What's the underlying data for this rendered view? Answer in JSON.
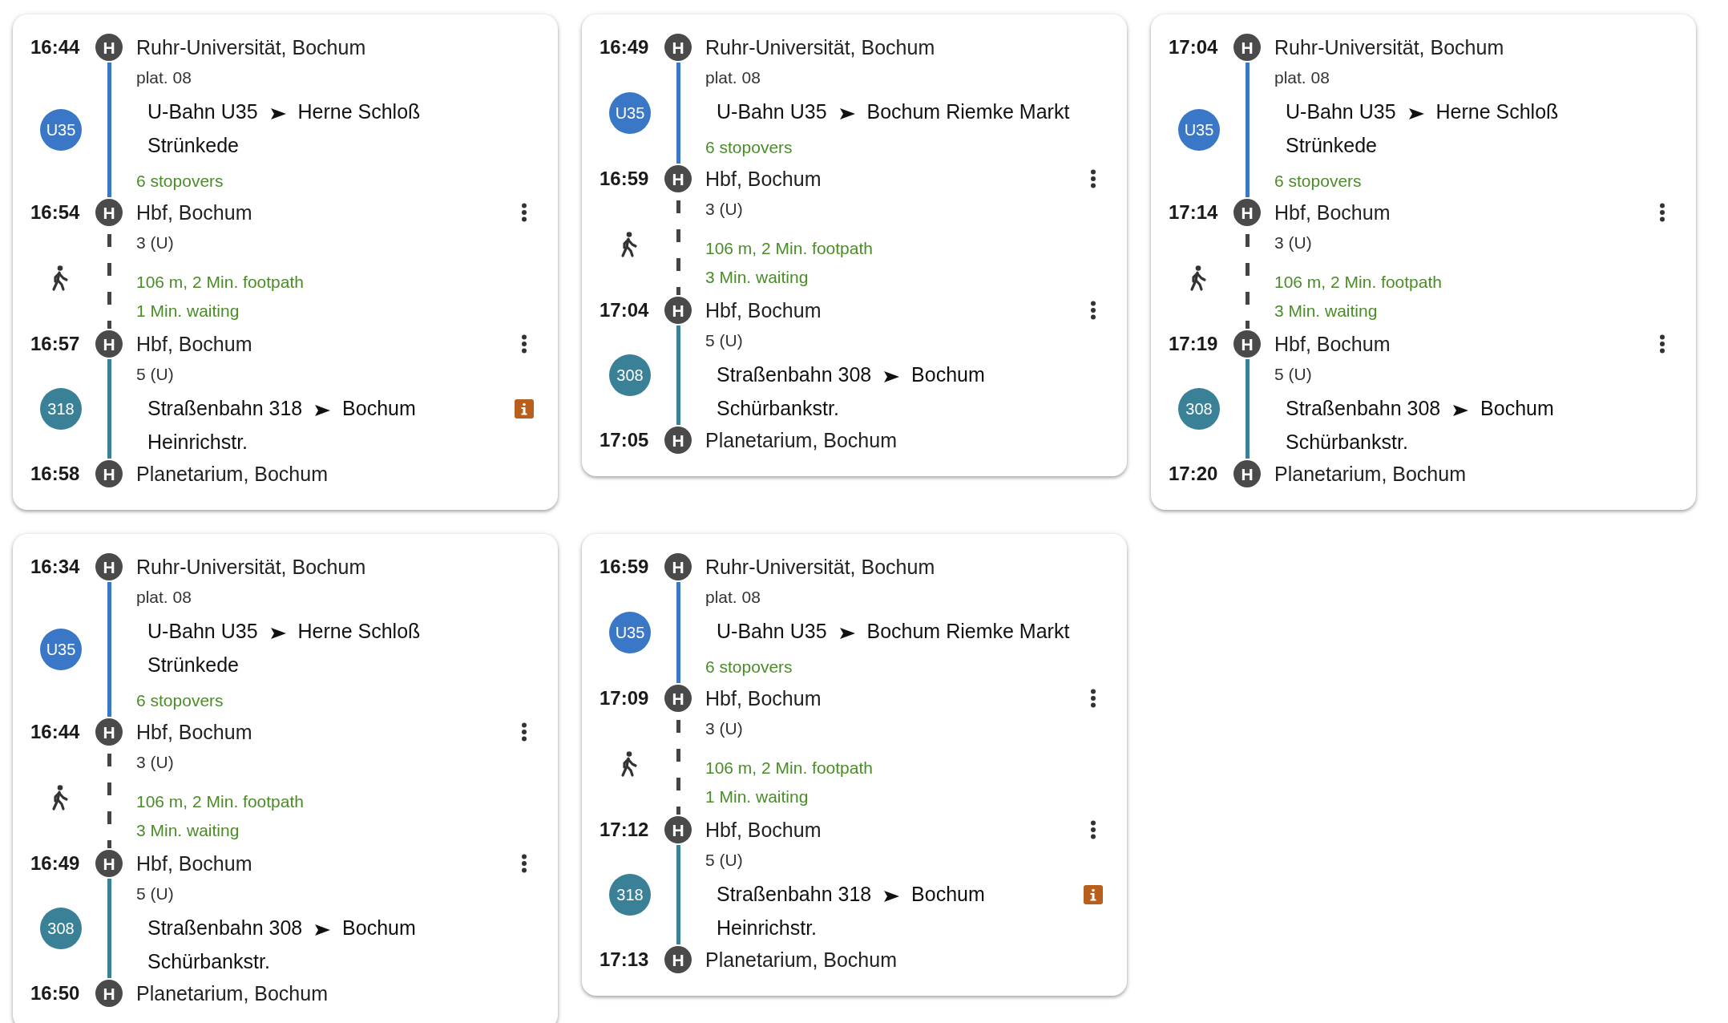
{
  "cards": [
    {
      "rows": [
        {
          "kind": "stop",
          "time": "16:44",
          "symbol": "H",
          "name": "Ruhr-Universität, Bochum",
          "platform": "plat. 08",
          "menu": false
        },
        {
          "kind": "ride",
          "badge": "U35",
          "color": "#3a77c6",
          "line": "U-Bahn U35",
          "direction": "Herne Schloß Strünkede",
          "stopovers": "6 stopovers",
          "info": false
        },
        {
          "kind": "stop",
          "time": "16:54",
          "symbol": "H",
          "name": "Hbf, Bochum",
          "platform": "3 (U)",
          "menu": true
        },
        {
          "kind": "walk",
          "footpath": "106 m, 2 Min. footpath",
          "waiting": "1 Min. waiting"
        },
        {
          "kind": "stop",
          "time": "16:57",
          "symbol": "H",
          "name": "Hbf, Bochum",
          "platform": "5 (U)",
          "menu": true
        },
        {
          "kind": "ride",
          "badge": "318",
          "color": "#3a8096",
          "line": "Straßenbahn 318",
          "direction": "Bochum Heinrichstr.",
          "info": true
        },
        {
          "kind": "stop",
          "time": "16:58",
          "symbol": "H",
          "name": "Planetarium, Bochum",
          "menu": false
        }
      ]
    },
    {
      "rows": [
        {
          "kind": "stop",
          "time": "16:49",
          "symbol": "H",
          "name": "Ruhr-Universität, Bochum",
          "platform": "plat. 08",
          "menu": false
        },
        {
          "kind": "ride",
          "badge": "U35",
          "color": "#3a77c6",
          "line": "U-Bahn U35",
          "direction": "Bochum Riemke Markt",
          "stopovers": "6 stopovers",
          "info": false
        },
        {
          "kind": "stop",
          "time": "16:59",
          "symbol": "H",
          "name": "Hbf, Bochum",
          "platform": "3 (U)",
          "menu": true
        },
        {
          "kind": "walk",
          "footpath": "106 m, 2 Min. footpath",
          "waiting": "3 Min. waiting"
        },
        {
          "kind": "stop",
          "time": "17:04",
          "symbol": "H",
          "name": "Hbf, Bochum",
          "platform": "5 (U)",
          "menu": true
        },
        {
          "kind": "ride",
          "badge": "308",
          "color": "#3a8096",
          "line": "Straßenbahn 308",
          "direction": "Bochum Schürbankstr.",
          "info": false
        },
        {
          "kind": "stop",
          "time": "17:05",
          "symbol": "H",
          "name": "Planetarium, Bochum",
          "menu": false
        }
      ]
    },
    {
      "rows": [
        {
          "kind": "stop",
          "time": "17:04",
          "symbol": "H",
          "name": "Ruhr-Universität, Bochum",
          "platform": "plat. 08",
          "menu": false
        },
        {
          "kind": "ride",
          "badge": "U35",
          "color": "#3a77c6",
          "line": "U-Bahn U35",
          "direction": "Herne Schloß Strünkede",
          "stopovers": "6 stopovers",
          "info": false
        },
        {
          "kind": "stop",
          "time": "17:14",
          "symbol": "H",
          "name": "Hbf, Bochum",
          "platform": "3 (U)",
          "menu": true
        },
        {
          "kind": "walk",
          "footpath": "106 m, 2 Min. footpath",
          "waiting": "3 Min. waiting"
        },
        {
          "kind": "stop",
          "time": "17:19",
          "symbol": "H",
          "name": "Hbf, Bochum",
          "platform": "5 (U)",
          "menu": true
        },
        {
          "kind": "ride",
          "badge": "308",
          "color": "#3a8096",
          "line": "Straßenbahn 308",
          "direction": "Bochum Schürbankstr.",
          "info": false
        },
        {
          "kind": "stop",
          "time": "17:20",
          "symbol": "H",
          "name": "Planetarium, Bochum",
          "menu": false
        }
      ]
    },
    {
      "rows": [
        {
          "kind": "stop",
          "time": "16:34",
          "symbol": "H",
          "name": "Ruhr-Universität, Bochum",
          "platform": "plat. 08",
          "menu": false
        },
        {
          "kind": "ride",
          "badge": "U35",
          "color": "#3a77c6",
          "line": "U-Bahn U35",
          "direction": "Herne Schloß Strünkede",
          "stopovers": "6 stopovers",
          "info": false
        },
        {
          "kind": "stop",
          "time": "16:44",
          "symbol": "H",
          "name": "Hbf, Bochum",
          "platform": "3 (U)",
          "menu": true
        },
        {
          "kind": "walk",
          "footpath": "106 m, 2 Min. footpath",
          "waiting": "3 Min. waiting"
        },
        {
          "kind": "stop",
          "time": "16:49",
          "symbol": "H",
          "name": "Hbf, Bochum",
          "platform": "5 (U)",
          "menu": true
        },
        {
          "kind": "ride",
          "badge": "308",
          "color": "#3a8096",
          "line": "Straßenbahn 308",
          "direction": "Bochum Schürbankstr.",
          "info": false
        },
        {
          "kind": "stop",
          "time": "16:50",
          "symbol": "H",
          "name": "Planetarium, Bochum",
          "menu": false
        }
      ]
    },
    {
      "rows": [
        {
          "kind": "stop",
          "time": "16:59",
          "symbol": "H",
          "name": "Ruhr-Universität, Bochum",
          "platform": "plat. 08",
          "menu": false
        },
        {
          "kind": "ride",
          "badge": "U35",
          "color": "#3a77c6",
          "line": "U-Bahn U35",
          "direction": "Bochum Riemke Markt",
          "stopovers": "6 stopovers",
          "info": false
        },
        {
          "kind": "stop",
          "time": "17:09",
          "symbol": "H",
          "name": "Hbf, Bochum",
          "platform": "3 (U)",
          "menu": true
        },
        {
          "kind": "walk",
          "footpath": "106 m, 2 Min. footpath",
          "waiting": "1 Min. waiting"
        },
        {
          "kind": "stop",
          "time": "17:12",
          "symbol": "H",
          "name": "Hbf, Bochum",
          "platform": "5 (U)",
          "menu": true
        },
        {
          "kind": "ride",
          "badge": "318",
          "color": "#3a8096",
          "line": "Straßenbahn 318",
          "direction": "Bochum Heinrichstr.",
          "info": true
        },
        {
          "kind": "stop",
          "time": "17:13",
          "symbol": "H",
          "name": "Planetarium, Bochum",
          "menu": false
        }
      ]
    }
  ]
}
